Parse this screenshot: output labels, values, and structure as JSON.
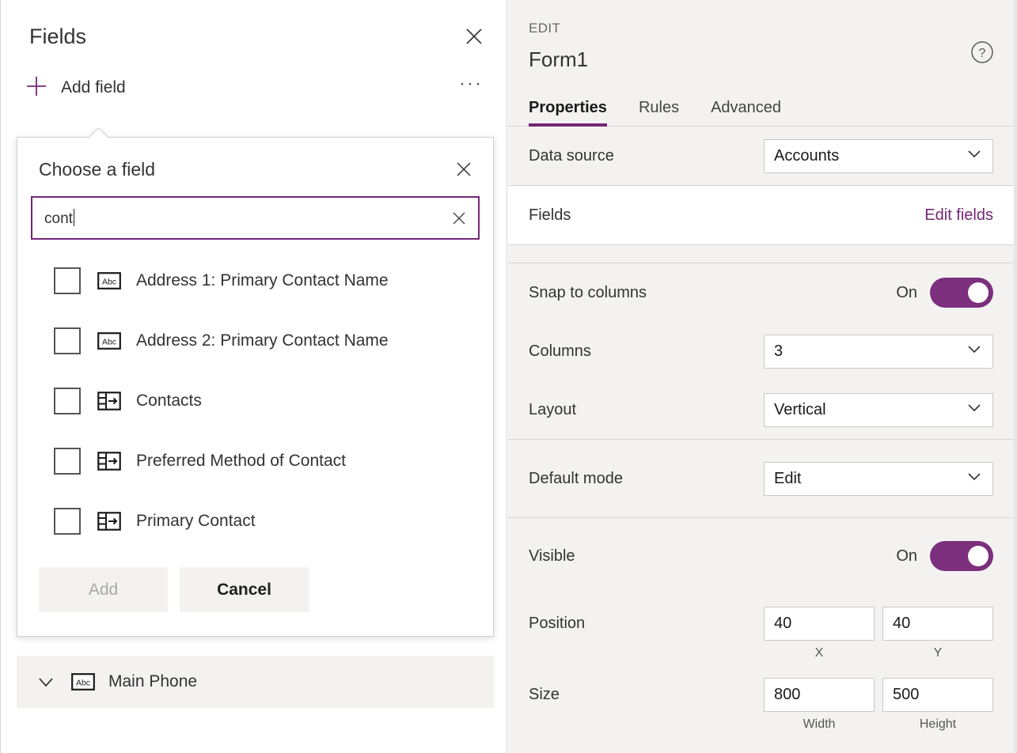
{
  "left_pane": {
    "title": "Fields",
    "close_icon": "close-icon",
    "add_field_label": "Add field",
    "add_icon": "plus-icon",
    "more_icon": "ellipsis-icon",
    "callout": {
      "title": "Choose a field",
      "close_icon": "close-icon",
      "search": {
        "value": "cont",
        "placeholder": "",
        "clear_icon": "clear-icon"
      },
      "items": [
        {
          "label": "Address 1: Primary Contact Name",
          "type_icon": "text-field-icon",
          "checked": false
        },
        {
          "label": "Address 2: Primary Contact Name",
          "type_icon": "text-field-icon",
          "checked": false
        },
        {
          "label": "Contacts",
          "type_icon": "lookup-field-icon",
          "checked": false
        },
        {
          "label": "Preferred Method of Contact",
          "type_icon": "lookup-field-icon",
          "checked": false
        },
        {
          "label": "Primary Contact",
          "type_icon": "lookup-field-icon",
          "checked": false
        }
      ],
      "add_button": "Add",
      "add_button_disabled": true,
      "cancel_button": "Cancel"
    },
    "collapsed_field": {
      "label": "Main Phone",
      "type_icon": "text-field-icon",
      "chevron_icon": "chevron-down-icon"
    }
  },
  "right_pane": {
    "kicker": "EDIT",
    "title": "Form1",
    "help_icon": "help-circle-icon",
    "tabs": [
      {
        "label": "Properties",
        "active": true
      },
      {
        "label": "Rules",
        "active": false
      },
      {
        "label": "Advanced",
        "active": false
      }
    ],
    "properties": {
      "data_source_label": "Data source",
      "data_source_value": "Accounts",
      "fields_label": "Fields",
      "edit_fields_link": "Edit fields",
      "snap_to_columns_label": "Snap to columns",
      "snap_to_columns_state": "On",
      "columns_label": "Columns",
      "columns_value": "3",
      "layout_label": "Layout",
      "layout_value": "Vertical",
      "default_mode_label": "Default mode",
      "default_mode_value": "Edit",
      "visible_label": "Visible",
      "visible_state": "On",
      "position_label": "Position",
      "position_x": "40",
      "position_y": "40",
      "position_x_caption": "X",
      "position_y_caption": "Y",
      "size_label": "Size",
      "size_width": "800",
      "size_height": "500",
      "size_width_caption": "Width",
      "size_height_caption": "Height"
    }
  },
  "colors": {
    "accent_purple": "#742774",
    "toggle_purple": "#7b2f7d",
    "panel_gray": "#f3f2f1",
    "divider": "#d6d6d6"
  }
}
